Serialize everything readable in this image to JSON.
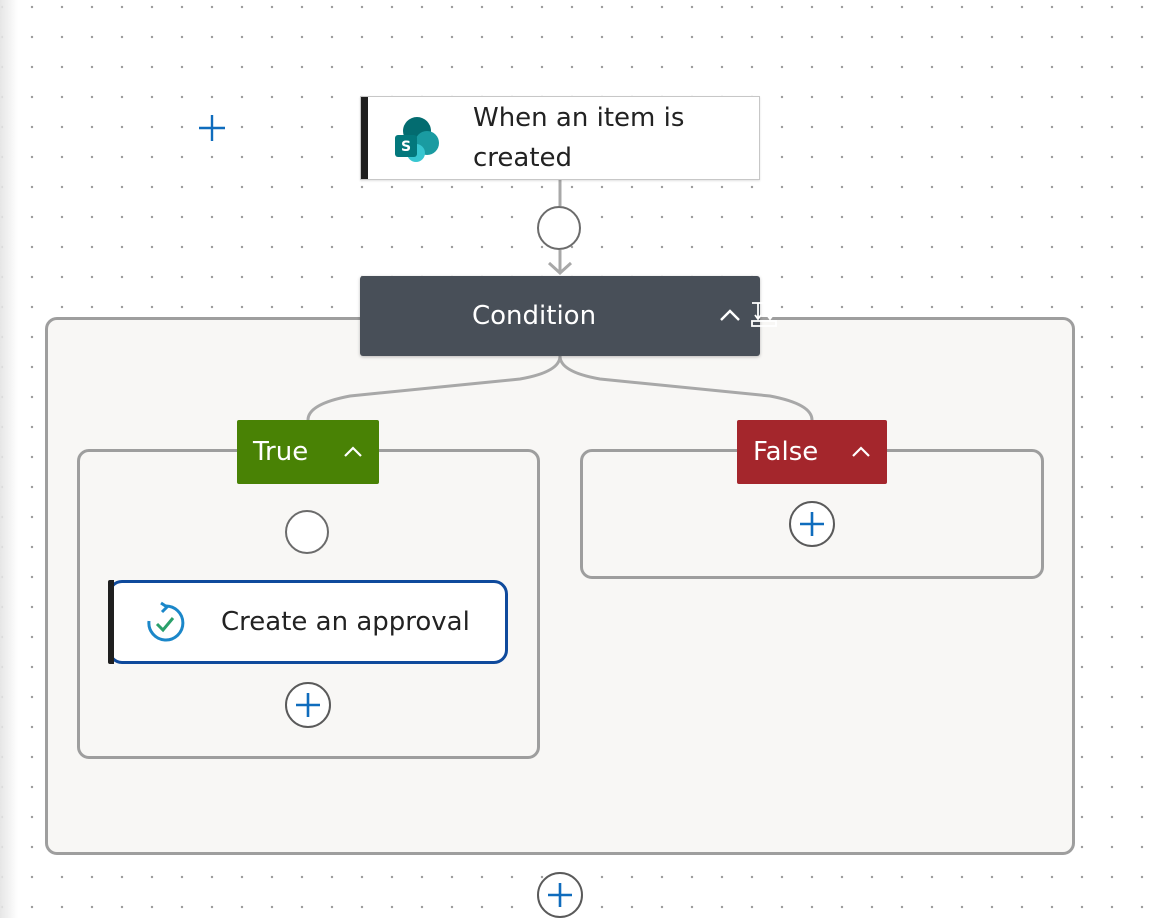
{
  "trigger": {
    "label": "When an item is created",
    "icon": "sharepoint-icon"
  },
  "condition": {
    "label": "Condition",
    "icon": "condition-icon",
    "collapse_icon": "chevron-up-icon"
  },
  "branches": {
    "true": {
      "label": "True",
      "collapse_icon": "chevron-up-icon",
      "color": "#498205"
    },
    "false": {
      "label": "False",
      "collapse_icon": "chevron-up-icon",
      "color": "#a4262c"
    }
  },
  "action": {
    "label": "Create an approval",
    "icon": "approval-icon"
  },
  "colors": {
    "accent_blue": "#0f6cbd",
    "condition_header": "#484f58",
    "selected_border": "#0f4a9c"
  }
}
